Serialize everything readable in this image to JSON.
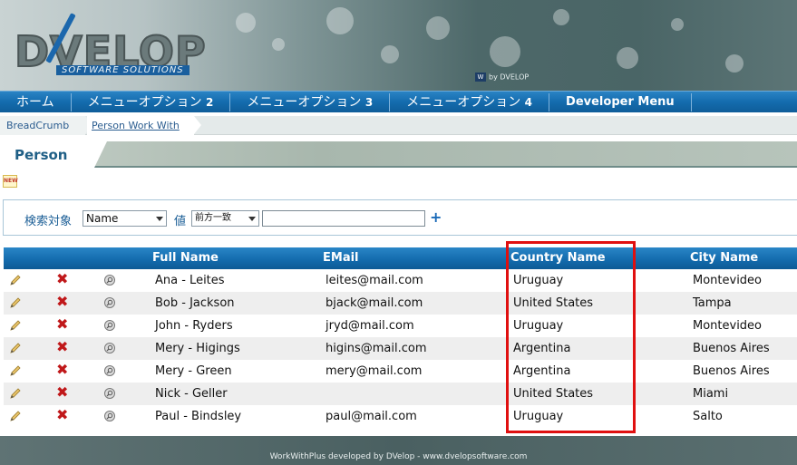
{
  "brand": {
    "logo_text": "DVELOP",
    "logo_sub": "SOFTWARE SOLUTIONS",
    "byline_box": "W",
    "byline": "by DVELOP"
  },
  "menu": {
    "items": [
      {
        "label": "ホーム",
        "num": ""
      },
      {
        "label": "メニューオプション ",
        "num": "2"
      },
      {
        "label": "メニューオプション ",
        "num": "3"
      },
      {
        "label": "メニューオプション ",
        "num": "4"
      },
      {
        "label": "Developer Menu",
        "num": ""
      }
    ]
  },
  "breadcrumb": {
    "first": "BreadCrumb",
    "second": "Person Work With"
  },
  "page": {
    "title": "Person",
    "new_icon": "NEW"
  },
  "filter": {
    "label": "検索対象",
    "field_value": "Name",
    "value_label": "値",
    "operator_value": "前方一致",
    "search_value": "",
    "plus": "+"
  },
  "grid": {
    "headers": {
      "full_name": "Full Name",
      "email": "EMail",
      "country": "Country Name",
      "city": "City Name"
    },
    "rows": [
      {
        "full_name": "Ana - Leites",
        "email": "leites@mail.com",
        "country": "Uruguay",
        "city": "Montevideo"
      },
      {
        "full_name": "Bob - Jackson",
        "email": "bjack@mail.com",
        "country": "United States",
        "city": "Tampa"
      },
      {
        "full_name": "John - Ryders",
        "email": "jryd@mail.com",
        "country": "Uruguay",
        "city": "Montevideo"
      },
      {
        "full_name": "Mery - Higings",
        "email": "higins@mail.com",
        "country": "Argentina",
        "city": "Buenos Aires"
      },
      {
        "full_name": "Mery - Green",
        "email": "mery@mail.com",
        "country": "Argentina",
        "city": "Buenos Aires"
      },
      {
        "full_name": "Nick - Geller",
        "email": "",
        "country": "United States",
        "city": "Miami"
      },
      {
        "full_name": "Paul - Bindsley",
        "email": "paul@mail.com",
        "country": "Uruguay",
        "city": "Salto"
      }
    ],
    "delete_glyph": "✖"
  },
  "footer": {
    "text": "WorkWithPlus developed by DVelop - www.dvelopsoftware.com"
  },
  "colors": {
    "menu_blue": "#146cae",
    "highlight_red": "#e01010",
    "delete_red": "#c0181a"
  }
}
